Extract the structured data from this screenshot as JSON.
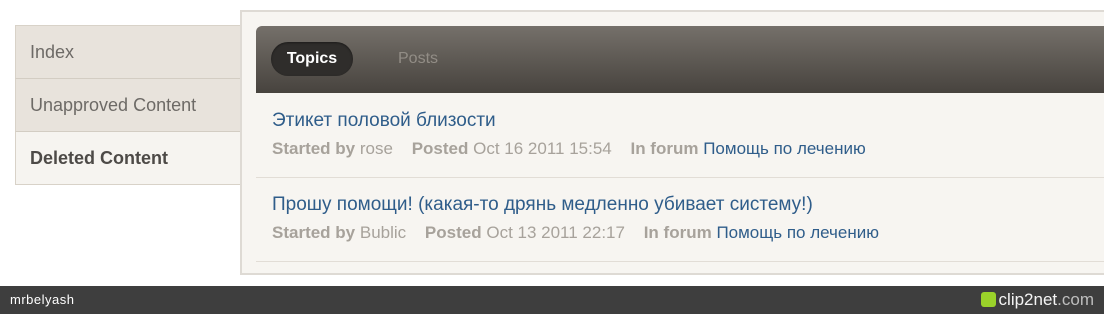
{
  "sidebar": {
    "items": [
      {
        "label": "Index"
      },
      {
        "label": "Unapproved Content"
      },
      {
        "label": "Deleted Content"
      }
    ]
  },
  "tabs": {
    "topics": "Topics",
    "posts": "Posts"
  },
  "topics": [
    {
      "title": "Этикет половой близости",
      "started_by_label": "Started by",
      "author": "rose",
      "posted_label": "Posted",
      "date": "Oct 16 2011 15:54",
      "in_forum_label": "In forum",
      "forum": "Помощь по лечению"
    },
    {
      "title": "Прошу помощи! (какая-то дрянь медленно убивает систему!)",
      "started_by_label": "Started by",
      "author": "Bublic",
      "posted_label": "Posted",
      "date": "Oct 13 2011 22:17",
      "in_forum_label": "In forum",
      "forum": "Помощь по лечению"
    }
  ],
  "footer": {
    "username": "mrbelyash",
    "brand": "clip2net",
    "brand_suffix": ".com"
  },
  "colors": {
    "accent_link": "#2f5d8a",
    "tab_active_bg": "#2f2d2b",
    "footer_bg": "#3e3e3e"
  },
  "icons": {
    "brand_logo": "clip2net-logo-icon"
  }
}
